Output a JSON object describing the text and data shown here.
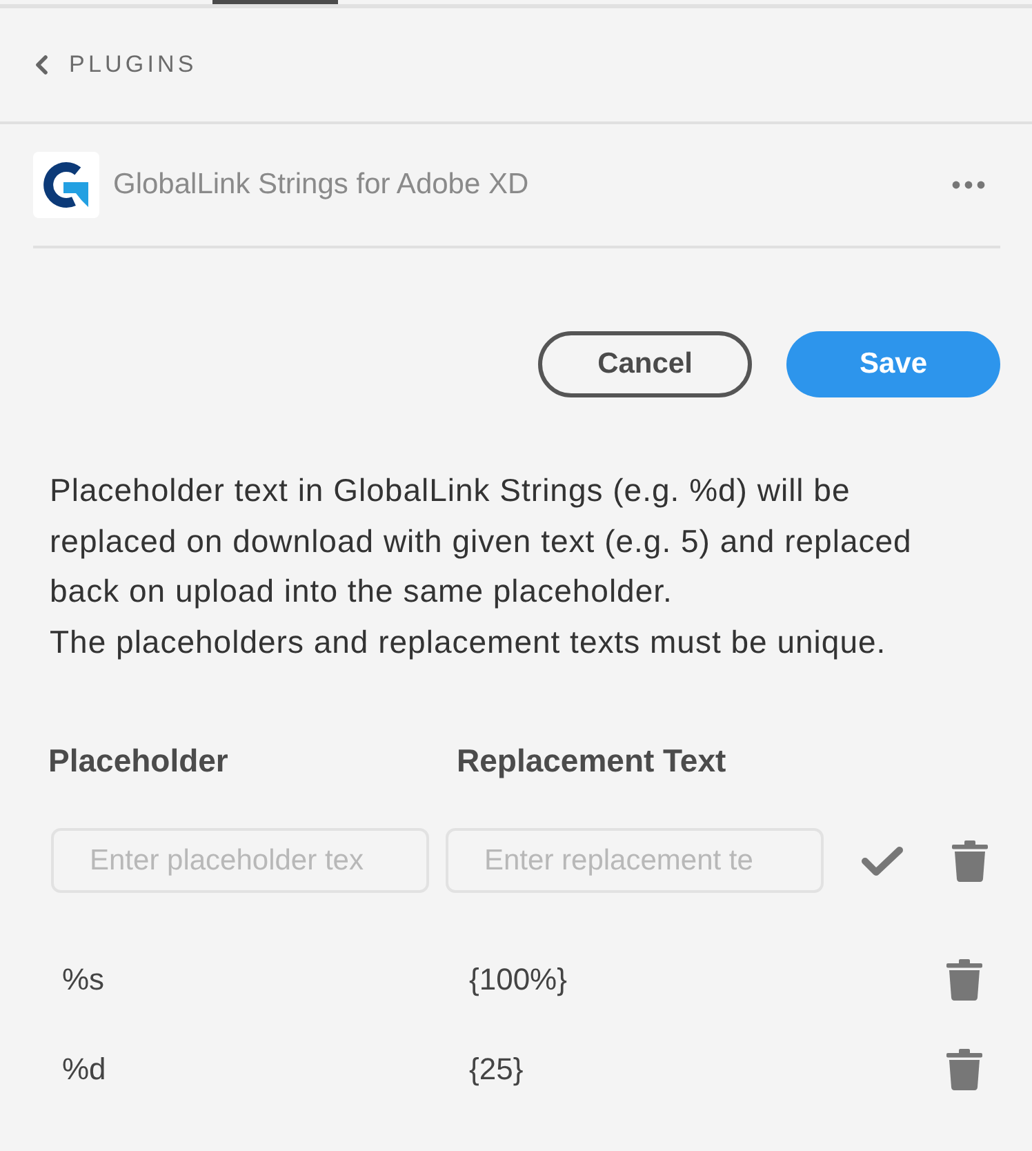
{
  "nav": {
    "back_label": "PLUGINS"
  },
  "plugin": {
    "name": "GlobalLink Strings for Adobe XD"
  },
  "actions": [
    {
      "kind": "secondary",
      "label": "Cancel"
    },
    {
      "kind": "primary",
      "label": "Save"
    }
  ],
  "description": [
    "Placeholder text in GlobalLink Strings (e.g. %d) will be replaced on download with given text (e.g. 5) and replaced back on upload into the same placeholder.",
    "The placeholders and replacement texts must be unique."
  ],
  "table": {
    "columns": [
      "Placeholder",
      "Replacement Text"
    ],
    "new_entry": {
      "placeholder_field": {
        "placeholder": "Enter placeholder tex"
      },
      "replacement_field": {
        "placeholder": "Enter replacement te"
      }
    },
    "rows": [
      {
        "placeholder": "%s",
        "replacement": "{100%}"
      },
      {
        "placeholder": "%d",
        "replacement": "{25}"
      }
    ]
  }
}
